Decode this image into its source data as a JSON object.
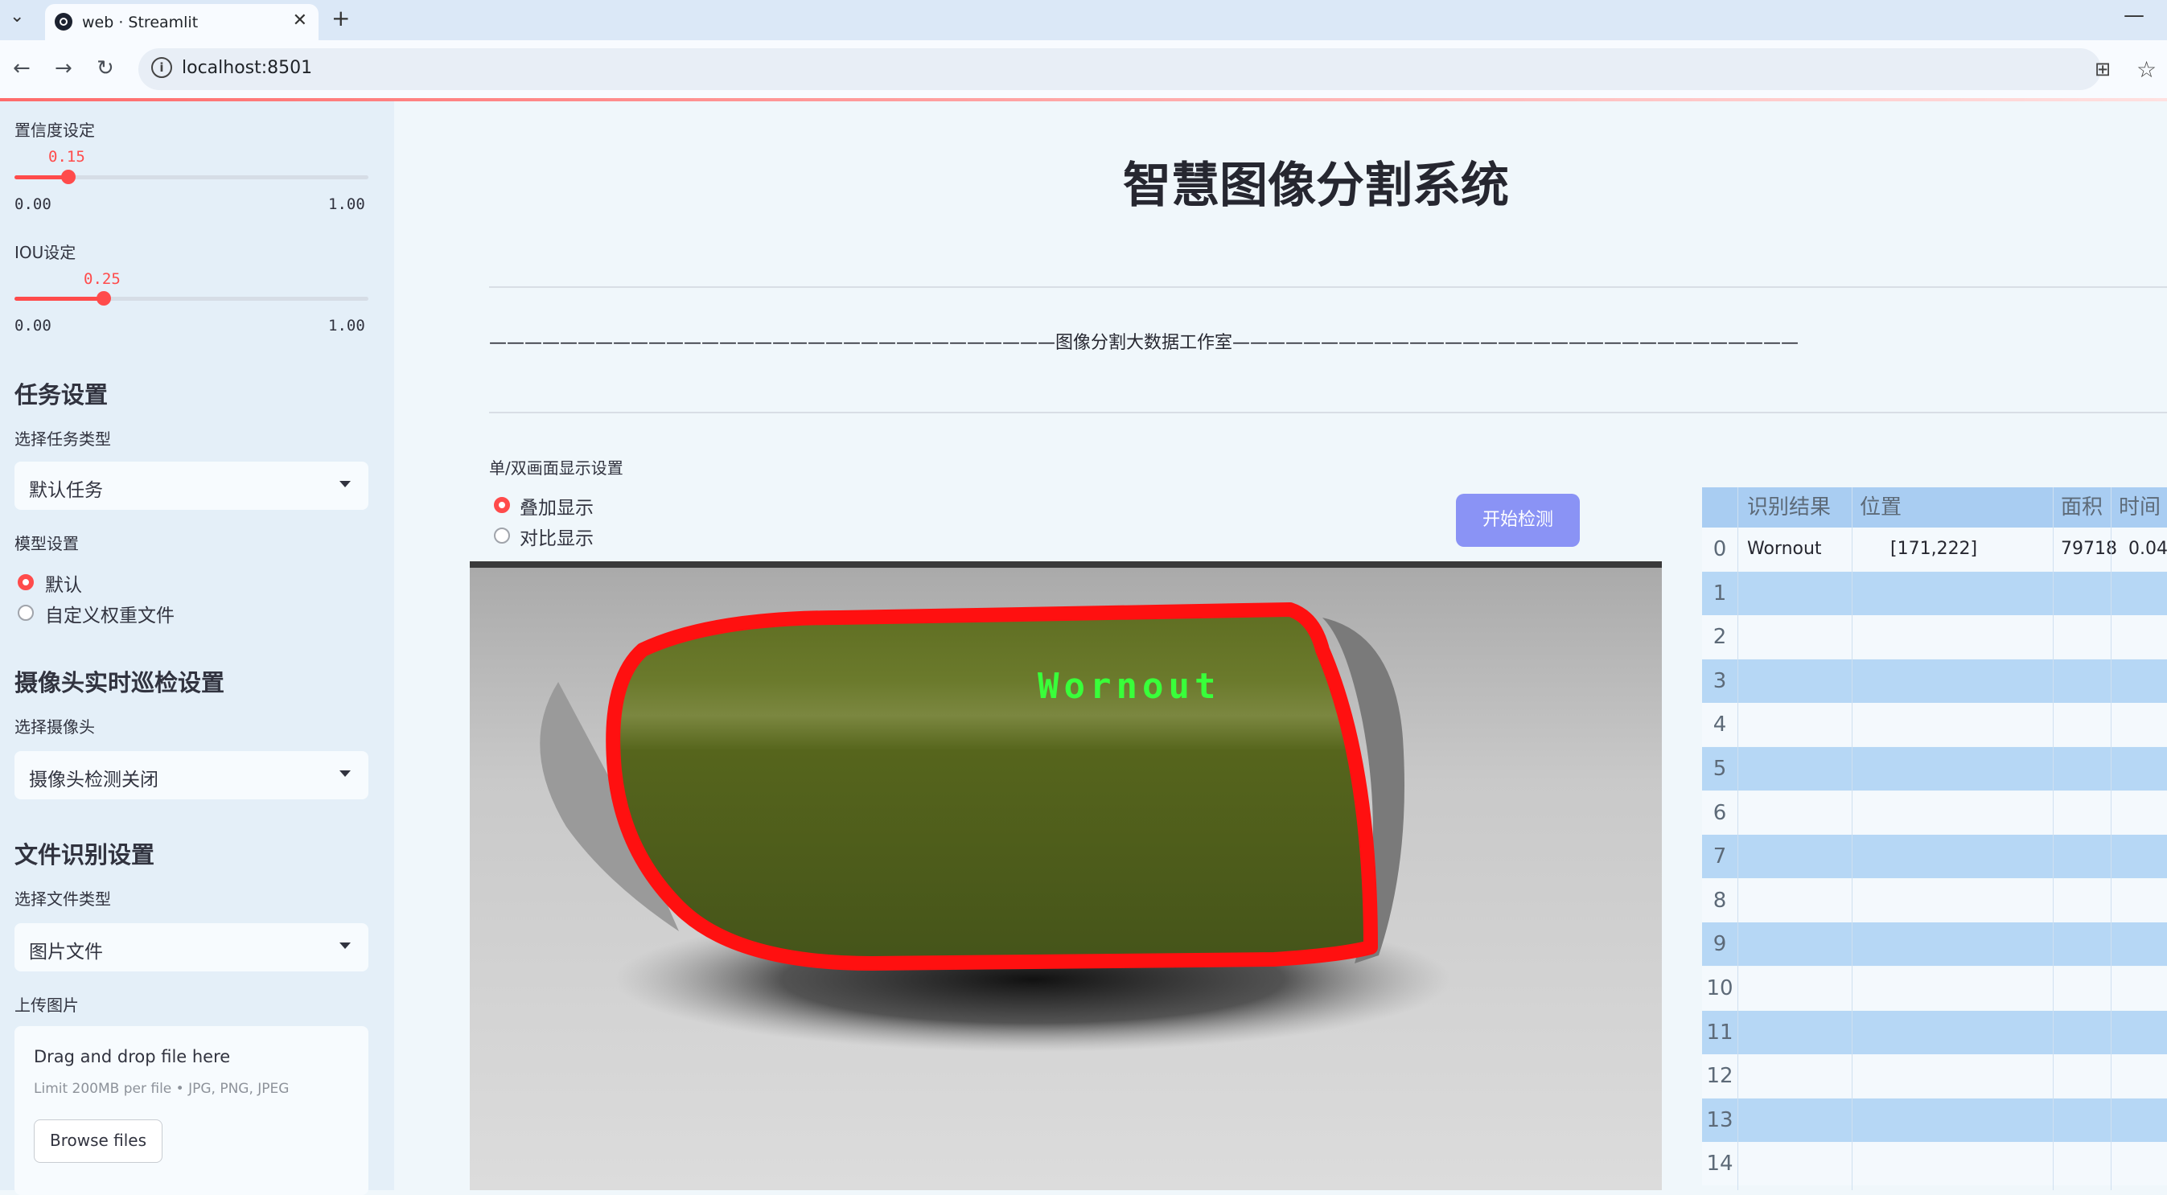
{
  "browser": {
    "tab_title": "web · Streamlit",
    "tab_close": "✕",
    "new_tab": "+",
    "url": "localhost:8501"
  },
  "sidebar": {
    "confidence": {
      "label": "置信度设定",
      "value": "0.15",
      "min": "0.00",
      "max": "1.00",
      "fraction": 0.15
    },
    "iou": {
      "label": "IOU设定",
      "value": "0.25",
      "min": "0.00",
      "max": "1.00",
      "fraction": 0.25
    },
    "task_heading": "任务设置",
    "task_type_label": "选择任务类型",
    "task_type_value": "默认任务",
    "model_label": "模型设置",
    "model_options": [
      "默认",
      "自定义权重文件"
    ],
    "camera_heading": "摄像头实时巡检设置",
    "camera_label": "选择摄像头",
    "camera_value": "摄像头检测关闭",
    "file_heading": "文件识别设置",
    "file_type_label": "选择文件类型",
    "file_type_value": "图片文件",
    "upload_label": "上传图片",
    "upload_drag": "Drag and drop file here",
    "upload_limit": "Limit 200MB per file • JPG, PNG, JPEG",
    "upload_button": "Browse files"
  },
  "main": {
    "title": "智慧图像分割系统",
    "divider_text": "————————————————————————————————图像分割大数据工作室————————————————————————————————",
    "display_mode_label": "单/双画面显示设置",
    "display_modes": [
      "叠加显示",
      "对比显示"
    ],
    "start_button": "开始检测",
    "detection_label": "Wornout"
  },
  "table": {
    "columns": [
      "识别结果",
      "位置",
      "面积",
      "时间"
    ],
    "rows": [
      {
        "index": "0",
        "result": "Wornout",
        "position": "[171,222]",
        "area": "79718",
        "time": "0.04"
      },
      {
        "index": "1"
      },
      {
        "index": "2"
      },
      {
        "index": "3"
      },
      {
        "index": "4"
      },
      {
        "index": "5"
      },
      {
        "index": "6"
      },
      {
        "index": "7"
      },
      {
        "index": "8"
      },
      {
        "index": "9"
      },
      {
        "index": "10"
      },
      {
        "index": "11"
      },
      {
        "index": "12"
      },
      {
        "index": "13"
      },
      {
        "index": "14"
      }
    ]
  },
  "colors": {
    "accent": "#ff4b4b",
    "button": "#8a93f5",
    "header": "#a9cdf2",
    "row_alt": "#b6d7f5"
  }
}
